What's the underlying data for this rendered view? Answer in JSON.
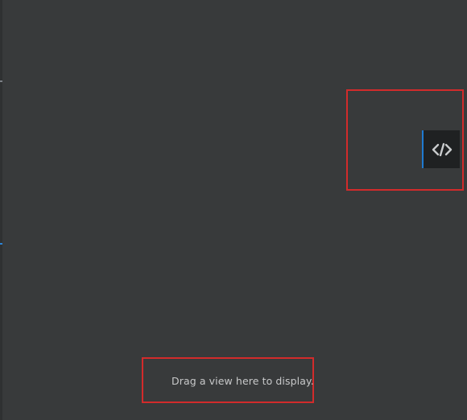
{
  "panel": {
    "background_color": "#383a3b",
    "drop_hint_text": "Drag a view here to display."
  },
  "view_button": {
    "icon": "source-code-icon",
    "accent_color": "#1f7ad1"
  },
  "highlights": {
    "color": "#d22b2b"
  }
}
